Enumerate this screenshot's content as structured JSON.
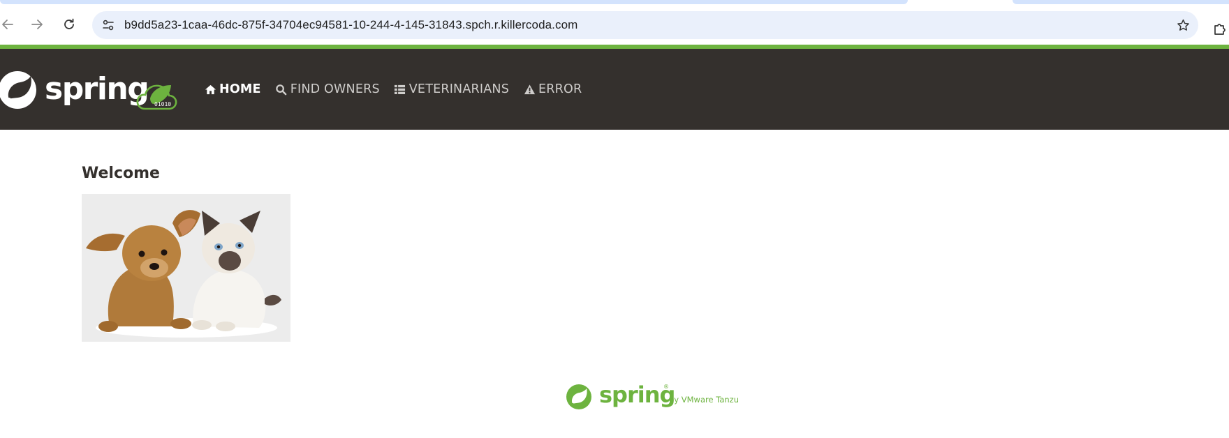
{
  "browser": {
    "url": "b9dd5a23-1caa-46dc-875f-34704ec94581-10-244-4-145-31843.spch.r.killercoda.com",
    "icons": [
      "back-arrow-icon",
      "forward-arrow-icon",
      "reload-icon",
      "site-settings-icon",
      "star-icon",
      "extensions-icon"
    ]
  },
  "navbar": {
    "brand_text": "spring",
    "brand_badge": "01010",
    "links": [
      {
        "label": "HOME",
        "icon": "home-icon",
        "active": true
      },
      {
        "label": "FIND OWNERS",
        "icon": "search-icon",
        "active": false
      },
      {
        "label": "VETERINARIANS",
        "icon": "list-icon",
        "active": false
      },
      {
        "label": "ERROR",
        "icon": "warning-icon",
        "active": false
      }
    ]
  },
  "main": {
    "title": "Welcome",
    "image": "pets-illustration"
  },
  "footer": {
    "logo_word": "spring",
    "logo_mark": "®",
    "byline": "by VMware Tanzu"
  },
  "colors": {
    "accent": "#6db33f",
    "navbar_bg": "#34302d",
    "nav_text": "#cfcdcb",
    "nav_active": "#ffffff"
  }
}
